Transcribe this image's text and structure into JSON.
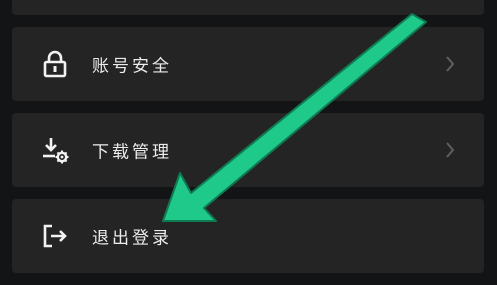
{
  "settings": {
    "items": [
      {
        "label": "账号安全",
        "icon": "lock-icon",
        "has_chevron": true
      },
      {
        "label": "下载管理",
        "icon": "download-gear-icon",
        "has_chevron": true
      },
      {
        "label": "退出登录",
        "icon": "logout-icon",
        "has_chevron": false
      }
    ]
  },
  "colors": {
    "background": "#131415",
    "card": "#242425",
    "text": "#ececec",
    "chevron": "#5e5e60",
    "annotation_arrow": "#1fc98a"
  }
}
